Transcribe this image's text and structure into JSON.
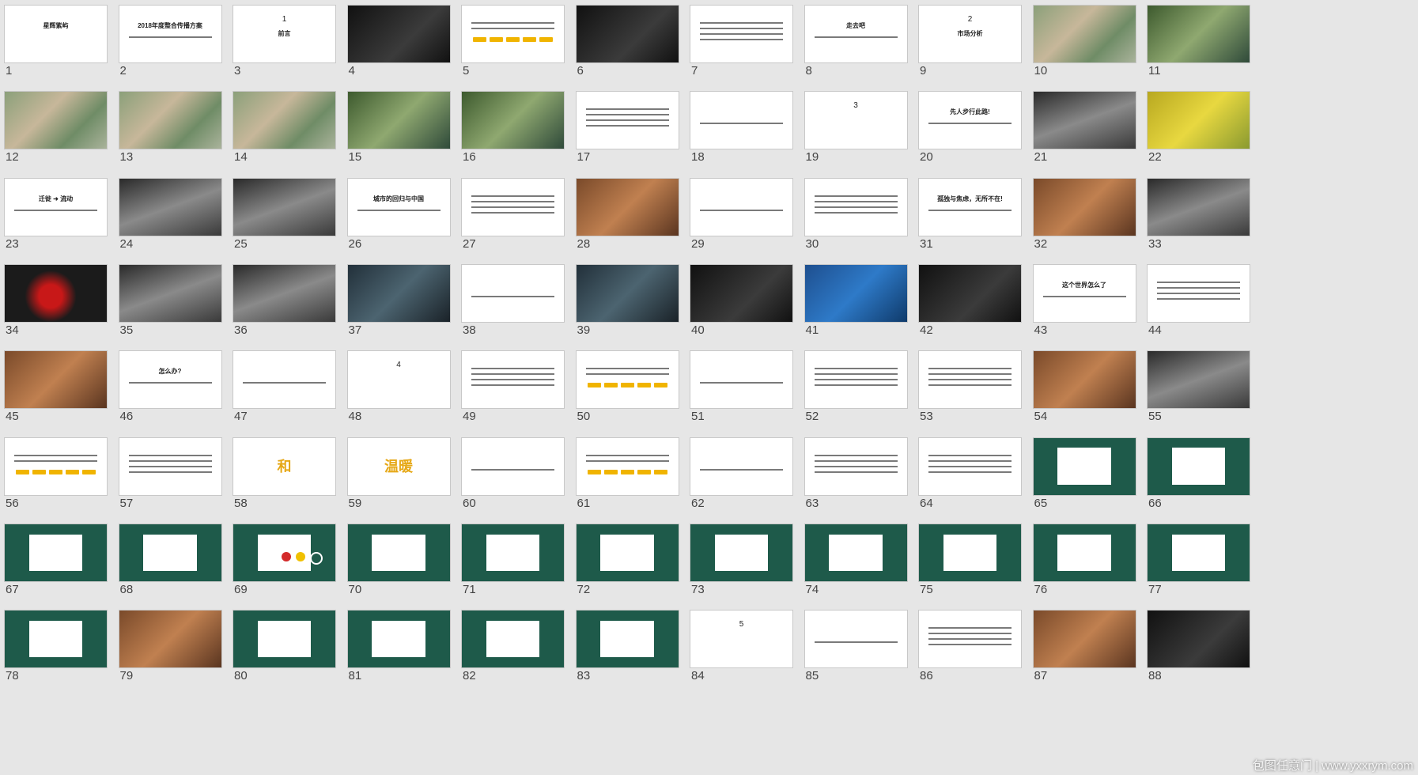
{
  "watermark": "包图任意门 | www.yxxrym.com",
  "slides": [
    {
      "n": "1",
      "style": "logo",
      "text": "星辉紫屿"
    },
    {
      "n": "2",
      "style": "title",
      "text": "2018年度整合传播方案"
    },
    {
      "n": "3",
      "style": "section",
      "num": "1",
      "text": "前言"
    },
    {
      "n": "4",
      "style": "photo-dark"
    },
    {
      "n": "5",
      "style": "text-chips"
    },
    {
      "n": "6",
      "style": "photo-dark"
    },
    {
      "n": "7",
      "style": "text"
    },
    {
      "n": "8",
      "style": "title",
      "text": "走去吧"
    },
    {
      "n": "9",
      "style": "section",
      "num": "2",
      "text": "市场分析"
    },
    {
      "n": "10",
      "style": "photo-map"
    },
    {
      "n": "11",
      "style": "photo-green"
    },
    {
      "n": "12",
      "style": "photo-map"
    },
    {
      "n": "13",
      "style": "photo-map"
    },
    {
      "n": "14",
      "style": "photo-map"
    },
    {
      "n": "15",
      "style": "photo-green"
    },
    {
      "n": "16",
      "style": "photo-green"
    },
    {
      "n": "17",
      "style": "table"
    },
    {
      "n": "18",
      "style": "title",
      "text": ""
    },
    {
      "n": "19",
      "style": "section",
      "num": "3",
      "text": ""
    },
    {
      "n": "20",
      "style": "title",
      "text": "先人步行此路!"
    },
    {
      "n": "21",
      "style": "photo-grey"
    },
    {
      "n": "22",
      "style": "photo-yellow"
    },
    {
      "n": "23",
      "style": "title",
      "text": "迁徙 ➜ 流动"
    },
    {
      "n": "24",
      "style": "photo-grey"
    },
    {
      "n": "25",
      "style": "photo-grey"
    },
    {
      "n": "26",
      "style": "title",
      "text": "城市的回归与中国"
    },
    {
      "n": "27",
      "style": "text"
    },
    {
      "n": "28",
      "style": "photo-warm"
    },
    {
      "n": "29",
      "style": "title",
      "text": ""
    },
    {
      "n": "30",
      "style": "text"
    },
    {
      "n": "31",
      "style": "title",
      "text": "孤独与焦虑，无所不在!"
    },
    {
      "n": "32",
      "style": "photo-warm"
    },
    {
      "n": "33",
      "style": "photo-grey"
    },
    {
      "n": "34",
      "style": "photo-red"
    },
    {
      "n": "35",
      "style": "photo-grey"
    },
    {
      "n": "36",
      "style": "photo-grey"
    },
    {
      "n": "37",
      "style": "photo-navy"
    },
    {
      "n": "38",
      "style": "title",
      "text": ""
    },
    {
      "n": "39",
      "style": "photo-navy"
    },
    {
      "n": "40",
      "style": "photo-dark"
    },
    {
      "n": "41",
      "style": "photo-blue"
    },
    {
      "n": "42",
      "style": "photo-dark"
    },
    {
      "n": "43",
      "style": "title",
      "text": "这个世界怎么了"
    },
    {
      "n": "44",
      "style": "text"
    },
    {
      "n": "45",
      "style": "photo-warm"
    },
    {
      "n": "46",
      "style": "title",
      "text": "怎么办?"
    },
    {
      "n": "47",
      "style": "title",
      "text": ""
    },
    {
      "n": "48",
      "style": "section",
      "num": "4",
      "text": ""
    },
    {
      "n": "49",
      "style": "text"
    },
    {
      "n": "50",
      "style": "text-chips"
    },
    {
      "n": "51",
      "style": "title",
      "text": ""
    },
    {
      "n": "52",
      "style": "text"
    },
    {
      "n": "53",
      "style": "text"
    },
    {
      "n": "54",
      "style": "photo-warm"
    },
    {
      "n": "55",
      "style": "photo-grey"
    },
    {
      "n": "56",
      "style": "text-chips"
    },
    {
      "n": "57",
      "style": "text"
    },
    {
      "n": "58",
      "style": "big",
      "text": "和"
    },
    {
      "n": "59",
      "style": "big",
      "text": "温暖"
    },
    {
      "n": "60",
      "style": "title",
      "text": ""
    },
    {
      "n": "61",
      "style": "text-chips"
    },
    {
      "n": "62",
      "style": "title",
      "text": ""
    },
    {
      "n": "63",
      "style": "text"
    },
    {
      "n": "64",
      "style": "text"
    },
    {
      "n": "65",
      "style": "green-card"
    },
    {
      "n": "66",
      "style": "green-card"
    },
    {
      "n": "67",
      "style": "green-card"
    },
    {
      "n": "68",
      "style": "green-card"
    },
    {
      "n": "69",
      "style": "green-circles"
    },
    {
      "n": "70",
      "style": "green-card"
    },
    {
      "n": "71",
      "style": "green-card"
    },
    {
      "n": "72",
      "style": "green-card"
    },
    {
      "n": "73",
      "style": "green-card"
    },
    {
      "n": "74",
      "style": "green-card"
    },
    {
      "n": "75",
      "style": "green-card"
    },
    {
      "n": "76",
      "style": "green-card"
    },
    {
      "n": "77",
      "style": "green-card"
    },
    {
      "n": "78",
      "style": "green-card"
    },
    {
      "n": "79",
      "style": "photo-warm"
    },
    {
      "n": "80",
      "style": "green-card"
    },
    {
      "n": "81",
      "style": "green-card"
    },
    {
      "n": "82",
      "style": "green-card"
    },
    {
      "n": "83",
      "style": "green-card"
    },
    {
      "n": "84",
      "style": "section",
      "num": "5",
      "text": ""
    },
    {
      "n": "85",
      "style": "title",
      "text": ""
    },
    {
      "n": "86",
      "style": "text"
    },
    {
      "n": "87",
      "style": "photo-warm"
    },
    {
      "n": "88",
      "style": "photo-dark"
    }
  ]
}
